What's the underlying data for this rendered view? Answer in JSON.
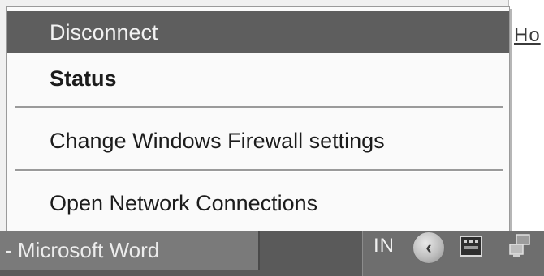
{
  "background_window": {
    "partial_text": "Ho"
  },
  "menu": {
    "items": [
      {
        "label": "Disconnect",
        "highlighted": true,
        "bold": false
      },
      {
        "label": "Status",
        "highlighted": false,
        "bold": true
      },
      {
        "label": "Change Windows Firewall settings",
        "highlighted": false,
        "bold": false
      },
      {
        "label": "Open Network Connections",
        "highlighted": false,
        "bold": false
      }
    ]
  },
  "taskbar": {
    "task_button_label": "- Microsoft Word",
    "language_indicator": "IN",
    "collapse_button_glyph": "‹",
    "tray_icons": [
      "keyboard-icon",
      "network-icon"
    ]
  },
  "colors": {
    "highlight": "#5e5e5e",
    "taskbar": "#5a5a5a",
    "menu_background": "#fafafa"
  }
}
